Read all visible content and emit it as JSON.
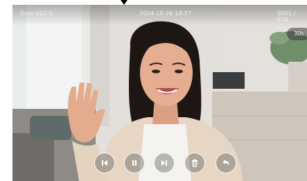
{
  "header": {
    "door_label": "Door 002-5",
    "datetime": "2024-10-26  14:57",
    "record_counter": "0051 / 028"
  },
  "countdown": {
    "label": "30s"
  },
  "controls": [
    {
      "name": "previous-button",
      "icon": "skip-previous-icon"
    },
    {
      "name": "pause-button",
      "icon": "pause-icon"
    },
    {
      "name": "next-button",
      "icon": "skip-next-icon"
    },
    {
      "name": "delete-button",
      "icon": "trash-icon"
    },
    {
      "name": "back-button",
      "icon": "return-arrow-icon"
    }
  ],
  "colors": {
    "wall": "#e6e3df",
    "window": "#f4f6f6",
    "sweater": "#e8dac8",
    "hair": "#1d1512",
    "skin": "#e3a98a"
  }
}
